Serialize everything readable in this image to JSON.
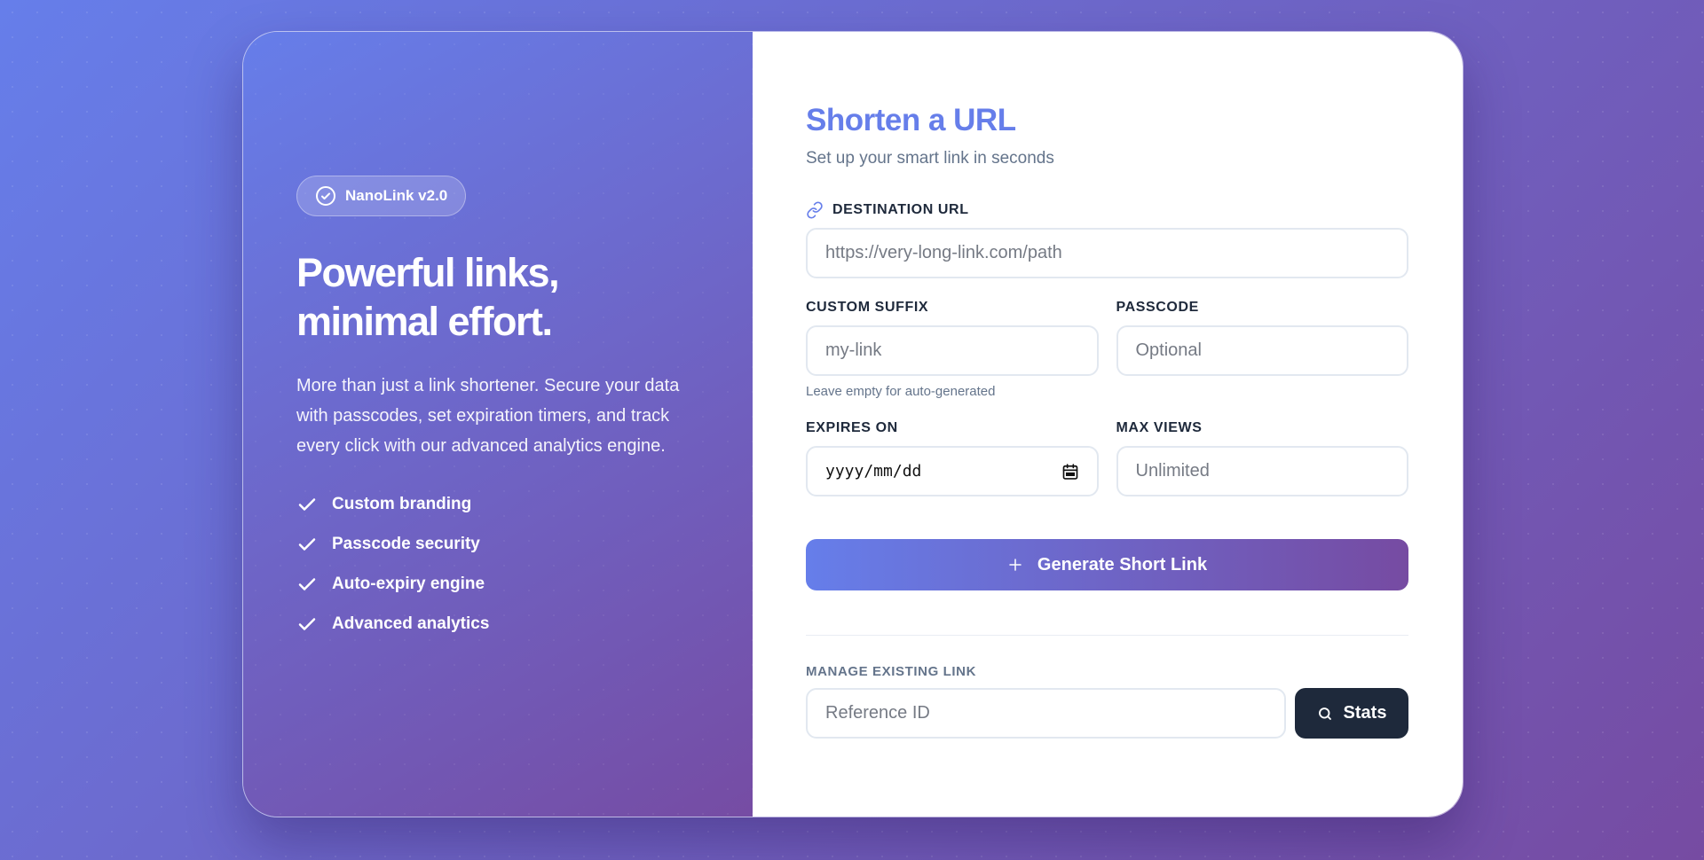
{
  "brand": {
    "badge_label": "NanoLink v2.0",
    "hero_title_line1": "Powerful links,",
    "hero_title_line2": "minimal effort.",
    "hero_description": "More than just a link shortener. Secure your data with passcodes, set expiration timers, and track every click with our advanced analytics engine.",
    "features": [
      "Custom branding",
      "Passcode security",
      "Auto-expiry engine",
      "Advanced analytics"
    ]
  },
  "form": {
    "title": "Shorten a URL",
    "subtitle": "Set up your smart link in seconds",
    "destination": {
      "label": "DESTINATION URL",
      "placeholder": "https://very-long-link.com/path",
      "value": ""
    },
    "suffix": {
      "label": "CUSTOM SUFFIX",
      "placeholder": "my-link",
      "hint": "Leave empty for auto-generated",
      "value": ""
    },
    "passcode": {
      "label": "PASSCODE",
      "placeholder": "Optional",
      "value": ""
    },
    "expires": {
      "label": "EXPIRES ON",
      "placeholder": "yyyy/mm/dd"
    },
    "max_views": {
      "label": "MAX VIEWS",
      "placeholder": "Unlimited",
      "value": ""
    },
    "generate_label": "Generate Short Link"
  },
  "manage": {
    "label": "MANAGE EXISTING LINK",
    "placeholder": "Reference ID",
    "button_label": "Stats"
  },
  "colors": {
    "gradient_start": "#667eea",
    "gradient_end": "#764ba2",
    "dark_button": "#1e293b"
  },
  "icons": {
    "badge": "check-circle-icon",
    "feature": "check-icon",
    "destination": "link-icon",
    "expires": "calendar-icon",
    "generate": "plus-icon",
    "stats": "search-icon"
  }
}
